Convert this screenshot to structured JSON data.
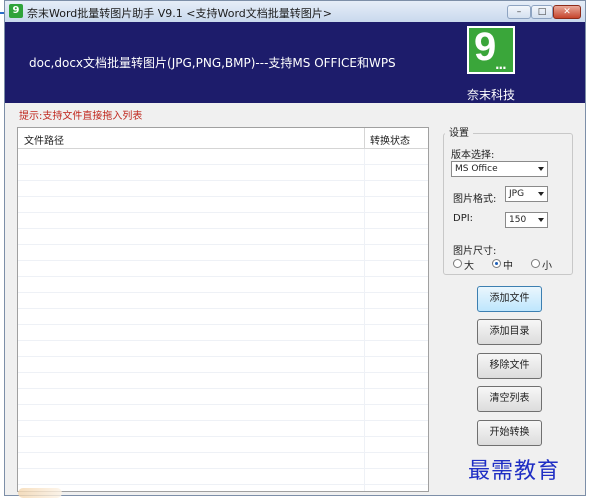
{
  "window": {
    "title": "奈末Word批量转图片助手 V9.1 <支持Word文档批量转图片>",
    "icon_glyph": "9",
    "controls": {
      "minimize": "–",
      "maximize": "□",
      "close": "✕"
    }
  },
  "banner": {
    "text": "doc,docx文档批量转图片(JPG,PNG,BMP)---支持MS OFFICE和WPS",
    "logo_digit": "9",
    "logo_dots": "...",
    "logo_name": "奈末科技",
    "colors": {
      "background": "#1d1c6b",
      "logo": "#3aa63a"
    }
  },
  "hint": "提示:支持文件直接拖入列表",
  "list": {
    "columns": [
      "文件路径",
      "转换状态"
    ],
    "rows": []
  },
  "settings": {
    "title": "设置",
    "version": {
      "label": "版本选择:",
      "value": "MS Office"
    },
    "format": {
      "label": "图片格式:",
      "value": "JPG"
    },
    "dpi": {
      "label": "DPI:",
      "value": "150"
    },
    "size": {
      "label": "图片尺寸:",
      "options": [
        "大",
        "中",
        "小"
      ],
      "selected": "中"
    }
  },
  "buttons": {
    "add_file": "添加文件",
    "add_dir": "添加目录",
    "remove_file": "移除文件",
    "clear_list": "清空列表",
    "start": "开始转换"
  },
  "watermark": "最需教育"
}
